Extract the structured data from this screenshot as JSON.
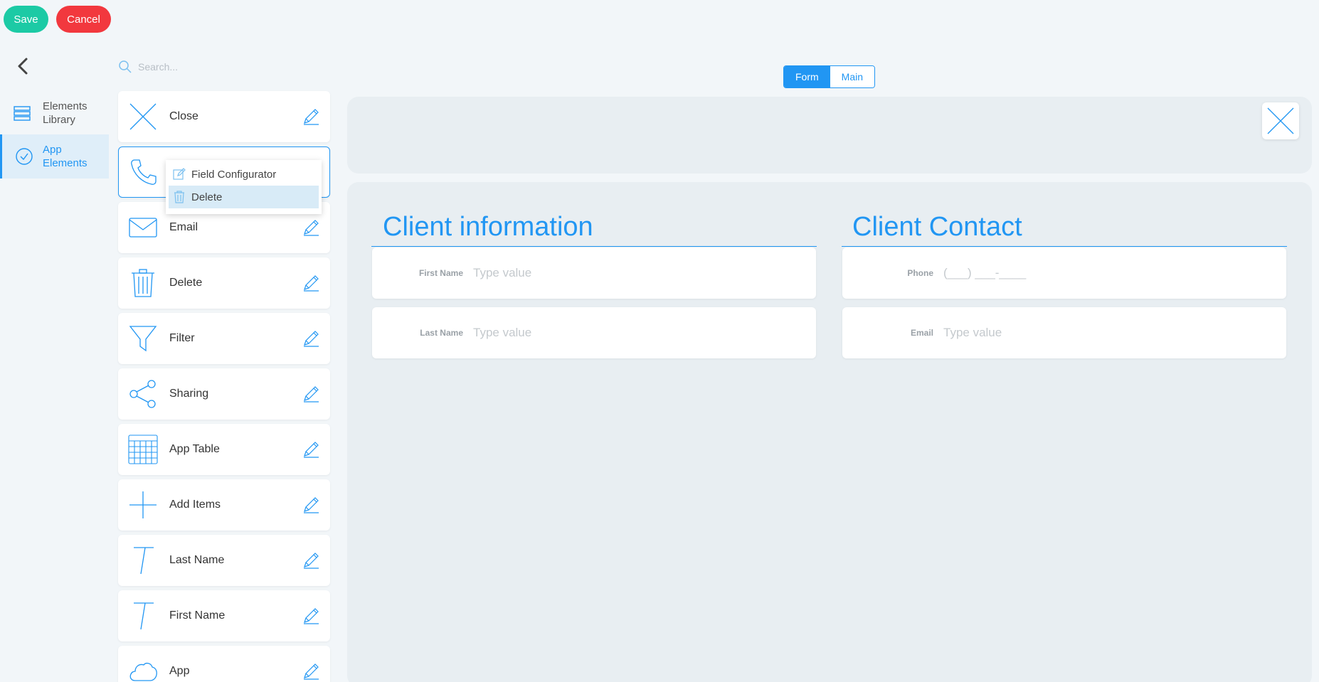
{
  "toolbar": {
    "save_label": "Save",
    "cancel_label": "Cancel"
  },
  "sidebar": {
    "items": [
      {
        "label": "Elements Library",
        "icon": "layers-icon",
        "active": false
      },
      {
        "label": "App Elements",
        "icon": "check-circle-icon",
        "active": true
      }
    ]
  },
  "search": {
    "placeholder": "Search..."
  },
  "library": {
    "items": [
      {
        "label": "Close",
        "icon": "close-icon"
      },
      {
        "label": "",
        "icon": "phone-icon",
        "active": true
      },
      {
        "label": "Email",
        "icon": "envelope-icon"
      },
      {
        "label": "Delete",
        "icon": "trash-icon"
      },
      {
        "label": "Filter",
        "icon": "filter-icon"
      },
      {
        "label": "Sharing",
        "icon": "share-icon"
      },
      {
        "label": "App Table",
        "icon": "table-icon"
      },
      {
        "label": "Add Items",
        "icon": "plus-icon"
      },
      {
        "label": "Last Name",
        "icon": "text-icon"
      },
      {
        "label": "First Name",
        "icon": "text-icon"
      },
      {
        "label": "App",
        "icon": "cloud-icon"
      }
    ]
  },
  "context_menu": {
    "items": [
      {
        "label": "Field Configurator",
        "icon": "edit-icon"
      },
      {
        "label": "Delete",
        "icon": "trash-icon",
        "highlighted": true
      }
    ]
  },
  "view_toggle": {
    "options": [
      "Form",
      "Main"
    ],
    "selected": "Form"
  },
  "form": {
    "sections": [
      {
        "title": "Client information",
        "fields": [
          {
            "label": "First Name",
            "placeholder": "Type value",
            "value": ""
          },
          {
            "label": "Last Name",
            "placeholder": "Type value",
            "value": ""
          }
        ]
      },
      {
        "title": "Client Contact",
        "fields": [
          {
            "label": "Phone",
            "placeholder": "(___) ___-____",
            "value": ""
          },
          {
            "label": "Email",
            "placeholder": "Type value",
            "value": ""
          }
        ]
      }
    ]
  },
  "colors": {
    "accent": "#2196f3",
    "save": "#1ccaa5",
    "cancel": "#f2383e",
    "background": "#f2f6f9",
    "panel": "#e8eef2"
  }
}
